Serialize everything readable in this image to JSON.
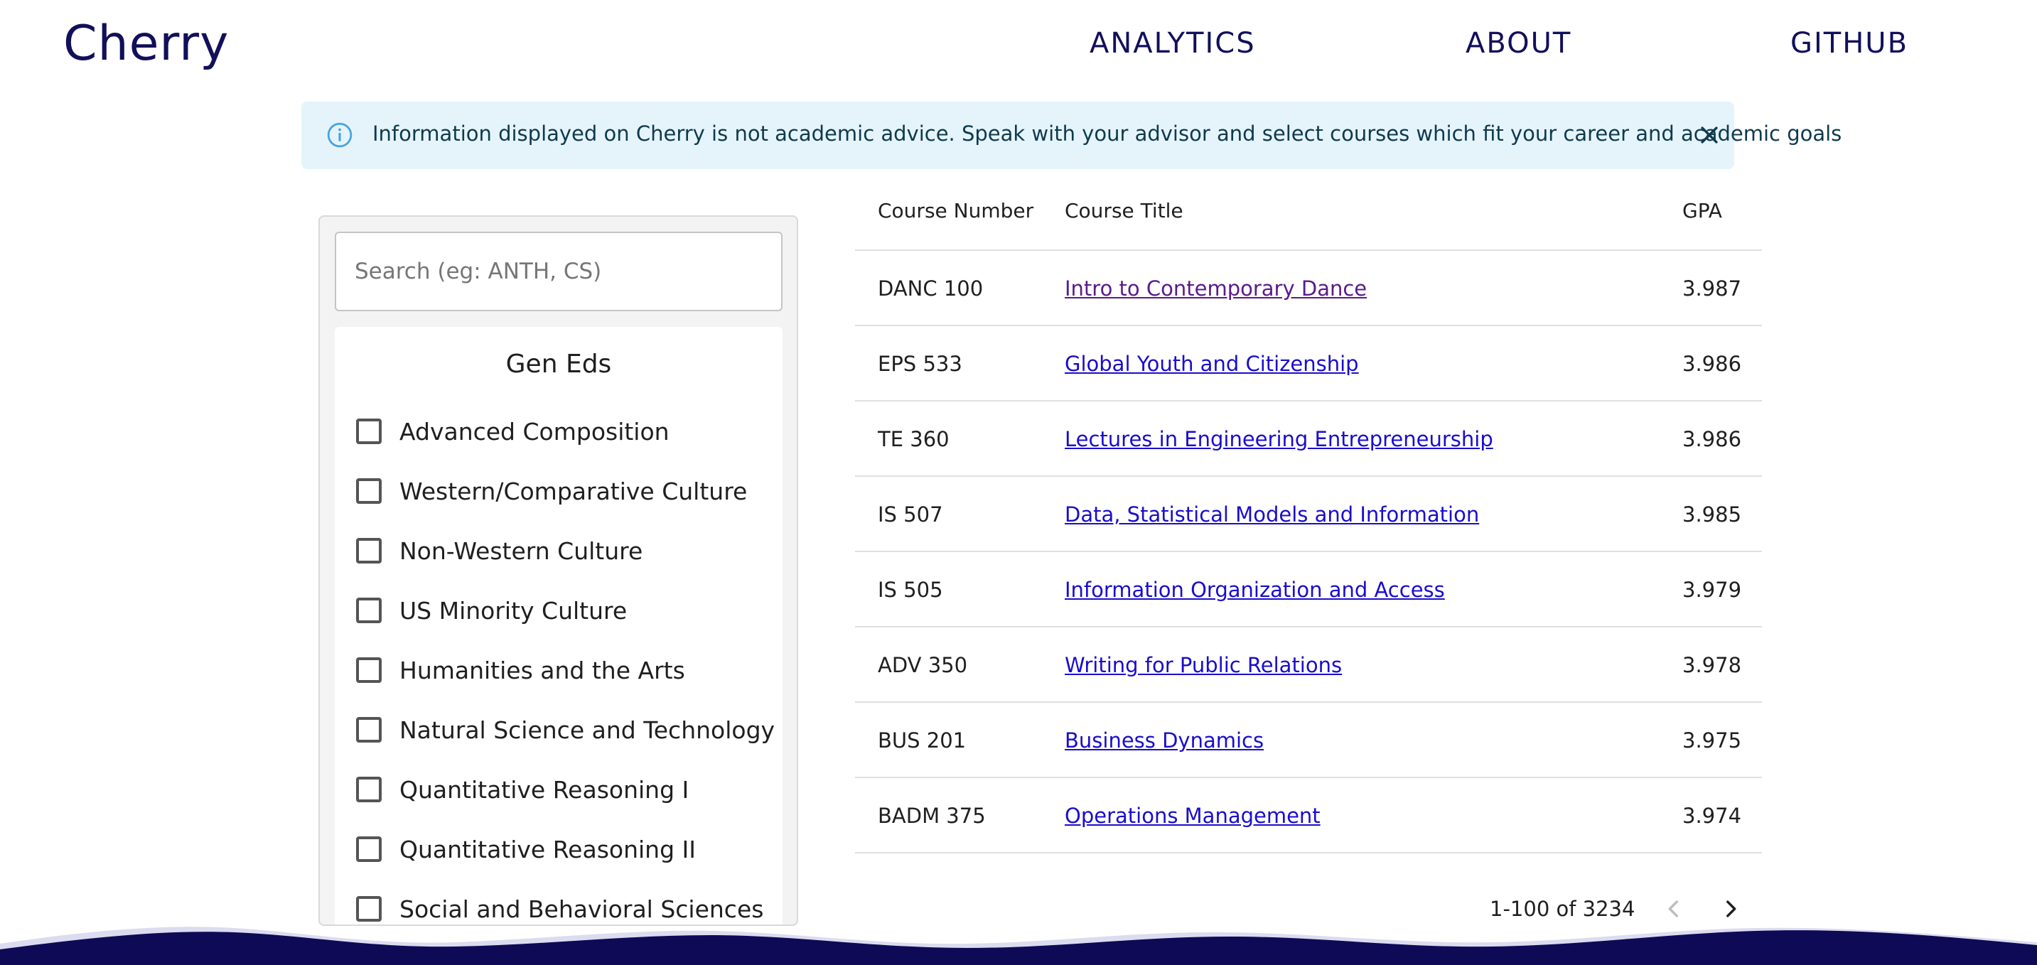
{
  "header": {
    "logo": "Cherry",
    "nav": {
      "analytics": "ANALYTICS",
      "about": "ABOUT",
      "github": "GITHUB"
    }
  },
  "alert": {
    "icon": "info-icon",
    "text": "Information displayed on Cherry is not academic advice. Speak with your advisor and select courses which fit your career and academic goals",
    "close_icon": "close-icon"
  },
  "sidebar": {
    "search": {
      "placeholder": "Search (eg: ANTH, CS)",
      "value": ""
    },
    "gen_eds": {
      "title": "Gen Eds",
      "items": [
        {
          "label": "Advanced Composition",
          "checked": false
        },
        {
          "label": "Western/Comparative Culture",
          "checked": false
        },
        {
          "label": "Non-Western Culture",
          "checked": false
        },
        {
          "label": "US Minority Culture",
          "checked": false
        },
        {
          "label": "Humanities and the Arts",
          "checked": false
        },
        {
          "label": "Natural Science and Technology",
          "checked": false
        },
        {
          "label": "Quantitative Reasoning I",
          "checked": false
        },
        {
          "label": "Quantitative Reasoning II",
          "checked": false
        },
        {
          "label": "Social and Behavioral Sciences",
          "checked": false
        }
      ]
    }
  },
  "table": {
    "columns": {
      "number": "Course Number",
      "title": "Course Title",
      "gpa": "GPA"
    },
    "rows": [
      {
        "number": "DANC 100",
        "title": "Intro to Contemporary Dance",
        "gpa": "3.987",
        "visited": true
      },
      {
        "number": "EPS 533",
        "title": "Global Youth and Citizenship",
        "gpa": "3.986",
        "visited": false
      },
      {
        "number": "TE 360",
        "title": "Lectures in Engineering Entrepreneurship",
        "gpa": "3.986",
        "visited": false
      },
      {
        "number": "IS 507",
        "title": "Data, Statistical Models and Information",
        "gpa": "3.985",
        "visited": false
      },
      {
        "number": "IS 505",
        "title": "Information Organization and Access",
        "gpa": "3.979",
        "visited": false
      },
      {
        "number": "ADV 350",
        "title": "Writing for Public Relations",
        "gpa": "3.978",
        "visited": false
      },
      {
        "number": "BUS 201",
        "title": "Business Dynamics",
        "gpa": "3.975",
        "visited": false
      },
      {
        "number": "BADM 375",
        "title": "Operations Management",
        "gpa": "3.974",
        "visited": false
      }
    ]
  },
  "pagination": {
    "range_text": "1-100 of 3234",
    "prev_icon": "chevron-left-icon",
    "next_icon": "chevron-right-icon",
    "prev_enabled": false,
    "next_enabled": true
  },
  "colors": {
    "brand": "#12105a",
    "link": "#1a0dcc",
    "link_visited": "#5a1a8c",
    "alert_bg": "#e5f4fb",
    "info_icon": "#4aa3df"
  }
}
